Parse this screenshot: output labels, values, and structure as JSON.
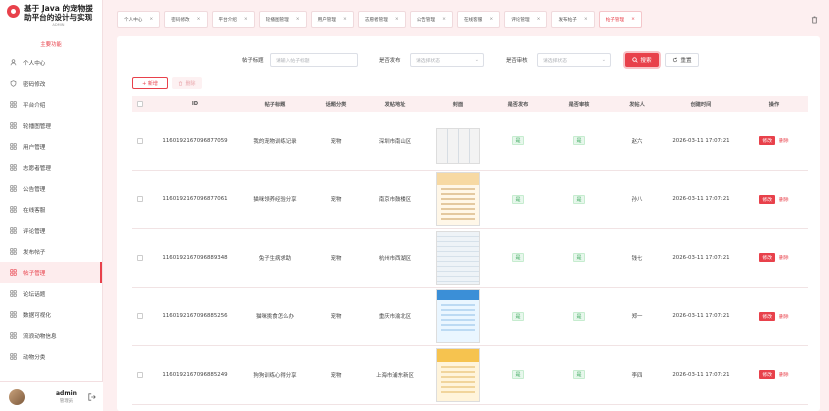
{
  "brand": {
    "title_line1": "基于 Java 的宠物援",
    "title_line2": "助平台的设计与实现",
    "subtitle": "ADMIN"
  },
  "sidebar": {
    "group_label": "主要功能",
    "items": [
      {
        "label": "个人中心",
        "icon": "person-icon"
      },
      {
        "label": "密码修改",
        "icon": "shield-icon"
      },
      {
        "label": "平台介绍",
        "icon": "grid-icon"
      },
      {
        "label": "轮播图管理",
        "icon": "grid-icon"
      },
      {
        "label": "用户管理",
        "icon": "grid-icon"
      },
      {
        "label": "志愿者管理",
        "icon": "grid-icon"
      },
      {
        "label": "公告管理",
        "icon": "grid-icon"
      },
      {
        "label": "在线客服",
        "icon": "grid-icon"
      },
      {
        "label": "评论管理",
        "icon": "grid-icon"
      },
      {
        "label": "发布帖子",
        "icon": "grid-icon"
      },
      {
        "label": "帖子管理",
        "icon": "grid-icon",
        "active": true
      },
      {
        "label": "论坛话题",
        "icon": "grid-icon"
      },
      {
        "label": "数据可视化",
        "icon": "grid-icon"
      },
      {
        "label": "流浪动物信息",
        "icon": "grid-icon"
      },
      {
        "label": "动物分类",
        "icon": "grid-icon"
      }
    ]
  },
  "user": {
    "name": "admin",
    "role": "管理员"
  },
  "tabs": [
    {
      "label": "个人中心"
    },
    {
      "label": "密码修改"
    },
    {
      "label": "平台介绍"
    },
    {
      "label": "轮播图管理"
    },
    {
      "label": "用户管理"
    },
    {
      "label": "志愿者管理"
    },
    {
      "label": "公告管理"
    },
    {
      "label": "在线客服"
    },
    {
      "label": "评论管理"
    },
    {
      "label": "发布帖子"
    },
    {
      "label": "帖子管理",
      "active": true
    }
  ],
  "filters": {
    "title_label": "帖子标题",
    "title_placeholder": "请输入帖子标题",
    "publish_label": "是否发布",
    "publish_placeholder": "请选择状态",
    "audit_label": "是否审核",
    "audit_placeholder": "请选择状态",
    "search_label": "搜索",
    "reset_label": "重置"
  },
  "actions": {
    "add_label": "+ 新增",
    "delete_label": "删除"
  },
  "table": {
    "headers": {
      "id": "ID",
      "title": "帖子标题",
      "category": "话题分类",
      "address": "发帖地址",
      "cover": "封面",
      "published": "是否发布",
      "audited": "是否审核",
      "author": "发帖人",
      "created": "创建时间",
      "ops": "操作"
    },
    "edit_label": "修改",
    "delete_label": "删除",
    "rows": [
      {
        "id": "1160192167096877059",
        "title": "我的宠物训练记录",
        "category": "宠物",
        "address": "深圳市南山区",
        "published": "是",
        "audited": "是",
        "author": "赵六",
        "created": "2026-03-11 17:07:21",
        "thumb": "t1"
      },
      {
        "id": "1160192167096877061",
        "title": "猫咪领养经验分享",
        "category": "宠物",
        "address": "南京市鼓楼区",
        "published": "是",
        "audited": "是",
        "author": "孙八",
        "created": "2026-03-11 17:07:21",
        "thumb": "t2"
      },
      {
        "id": "1160192167096889348",
        "title": "兔子生病求助",
        "category": "宠物",
        "address": "杭州市西湖区",
        "published": "是",
        "audited": "是",
        "author": "钱七",
        "created": "2026-03-11 17:07:21",
        "thumb": "t3"
      },
      {
        "id": "1160192167096885256",
        "title": "猫咪挑食怎么办",
        "category": "宠物",
        "address": "重庆市渝北区",
        "published": "是",
        "audited": "是",
        "author": "郑一",
        "created": "2026-03-11 17:07:21",
        "thumb": "t4"
      },
      {
        "id": "1160192167096885249",
        "title": "狗狗训练心得分享",
        "category": "宠物",
        "address": "上海市浦东新区",
        "published": "是",
        "audited": "是",
        "author": "李四",
        "created": "2026-03-11 17:07:21",
        "thumb": "t5"
      }
    ]
  },
  "colors": {
    "accent": "#e8414b",
    "bg": "#fdeff0",
    "tag_green": "#3aa85b"
  }
}
